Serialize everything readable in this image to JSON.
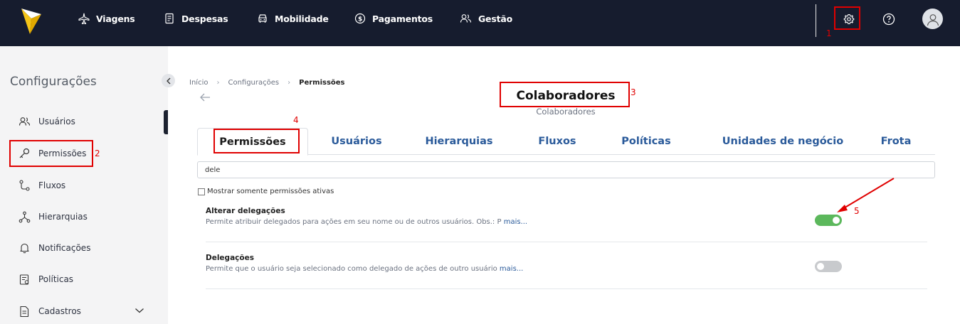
{
  "colors": {
    "topbar": "#161c2e",
    "accent_blue": "#2a5a9a",
    "toggle_on": "#5cb85c",
    "toggle_off": "#c8cacd",
    "annotation": "#e00000"
  },
  "topbar": {
    "nav": [
      {
        "label": "Viagens",
        "icon": "airplane-icon"
      },
      {
        "label": "Despesas",
        "icon": "receipt-icon"
      },
      {
        "label": "Mobilidade",
        "icon": "car-icon"
      },
      {
        "label": "Pagamentos",
        "icon": "dollar-circle-icon"
      },
      {
        "label": "Gestão",
        "icon": "users-icon"
      }
    ],
    "icons": [
      "gear-icon",
      "help-icon",
      "avatar-icon"
    ]
  },
  "sidebar": {
    "title": "Configurações",
    "items": [
      {
        "label": "Usuários",
        "icon": "users-icon"
      },
      {
        "label": "Permissões",
        "icon": "key-icon"
      },
      {
        "label": "Fluxos",
        "icon": "flow-icon"
      },
      {
        "label": "Hierarquias",
        "icon": "hierarchy-icon"
      },
      {
        "label": "Notificações",
        "icon": "bell-icon"
      },
      {
        "label": "Políticas",
        "icon": "policy-icon"
      },
      {
        "label": "Cadastros",
        "icon": "document-icon"
      }
    ]
  },
  "breadcrumb": [
    "Início",
    "Configurações",
    "Permissões"
  ],
  "page": {
    "title": "Colaboradores",
    "subtitle": "Colaboradores"
  },
  "tabs": [
    "Permissões",
    "Usuários",
    "Hierarquias",
    "Fluxos",
    "Políticas",
    "Unidades de negócio",
    "Frota"
  ],
  "search": {
    "value": "dele"
  },
  "filter": {
    "label": "Mostrar somente permissões ativas",
    "checked": false
  },
  "permissions": [
    {
      "title": "Alterar delegações",
      "description": "Permite atribuir delegados para ações em seu nome ou de outros usuários. Obs.: P",
      "more": "mais...",
      "enabled": true
    },
    {
      "title": "Delegações",
      "description": "Permite que o usuário seja selecionado como delegado de ações de outro usuário",
      "more": "mais...",
      "enabled": false
    }
  ],
  "annotations": [
    "1",
    "2",
    "3",
    "4",
    "5"
  ]
}
